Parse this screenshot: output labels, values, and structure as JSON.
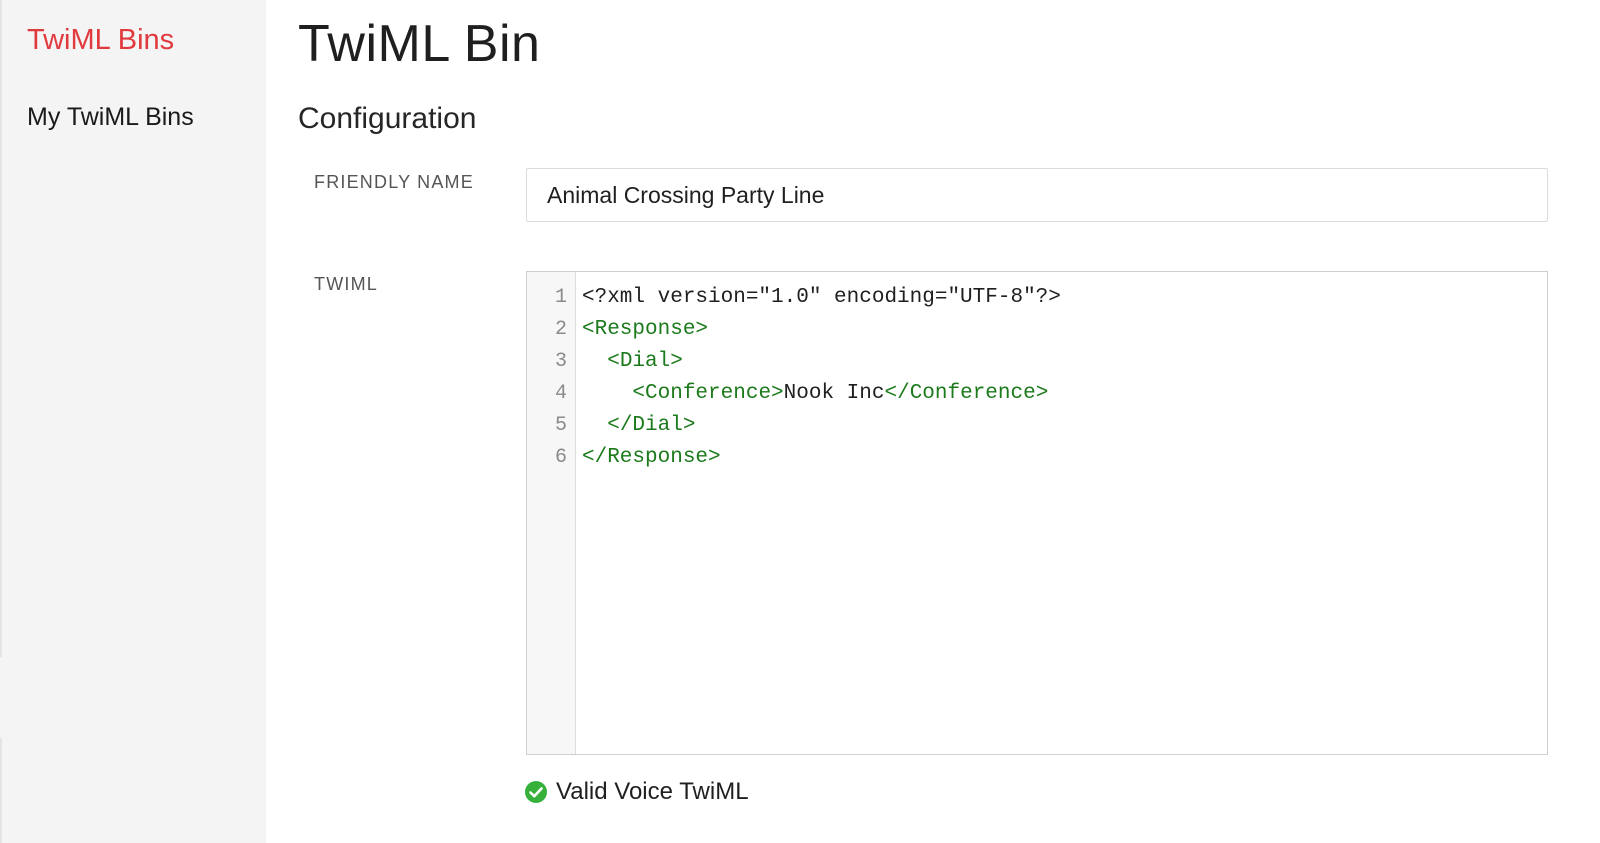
{
  "sidebar": {
    "title": "TwiML Bins",
    "items": [
      {
        "label": "My TwiML Bins"
      }
    ]
  },
  "main": {
    "page_title": "TwiML Bin",
    "section_title": "Configuration",
    "fields": {
      "friendly_name": {
        "label": "FRIENDLY NAME",
        "value": "Animal Crossing Party Line"
      },
      "twiml": {
        "label": "TWIML",
        "line_numbers": [
          "1",
          "2",
          "3",
          "4",
          "5",
          "6"
        ],
        "lines": [
          {
            "indent": "",
            "parts": [
              {
                "text": "<?xml version=\"1.0\" encoding=\"UTF-8\"?>",
                "kind": "plain"
              }
            ]
          },
          {
            "indent": "",
            "parts": [
              {
                "text": "<Response>",
                "kind": "tag"
              }
            ]
          },
          {
            "indent": "  ",
            "parts": [
              {
                "text": "<Dial>",
                "kind": "tag"
              }
            ]
          },
          {
            "indent": "    ",
            "parts": [
              {
                "text": "<Conference>",
                "kind": "tag"
              },
              {
                "text": "Nook Inc",
                "kind": "plain"
              },
              {
                "text": "</Conference>",
                "kind": "tag"
              }
            ]
          },
          {
            "indent": "  ",
            "parts": [
              {
                "text": "</Dial>",
                "kind": "tag"
              }
            ]
          },
          {
            "indent": "",
            "parts": [
              {
                "text": "</Response>",
                "kind": "tag"
              }
            ]
          }
        ]
      }
    },
    "validation": {
      "icon": "check-circle-icon",
      "text": "Valid Voice TwiML"
    }
  },
  "colors": {
    "brand_red": "#e0393e",
    "xml_tag_green": "#1b7a1b",
    "valid_green": "#36b03b",
    "sidebar_bg": "#f4f4f4"
  }
}
